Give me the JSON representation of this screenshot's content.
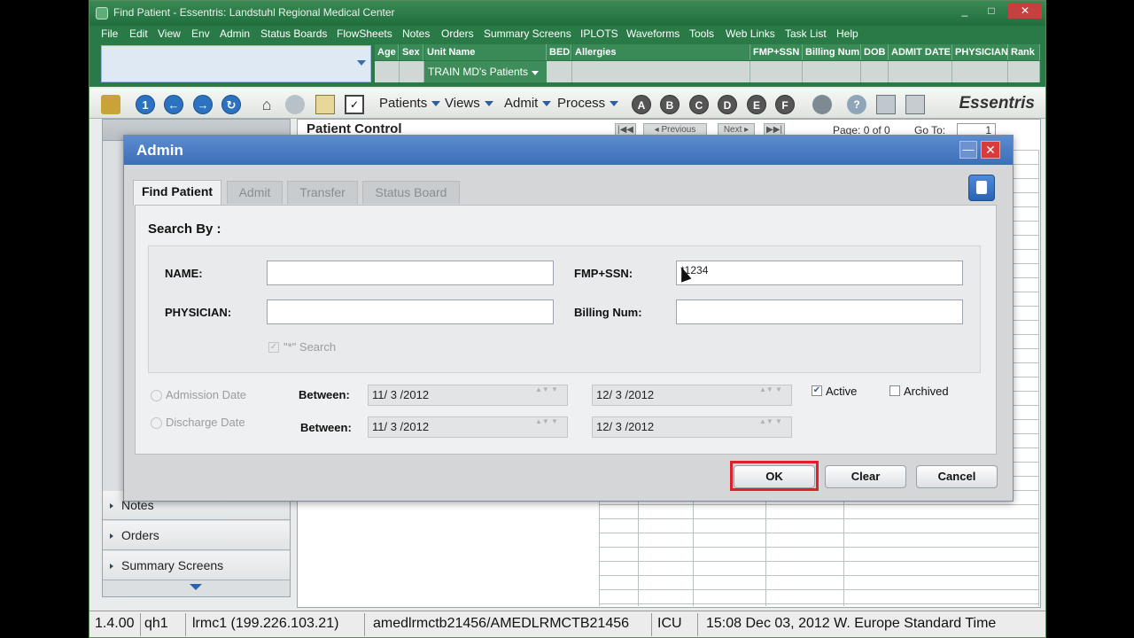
{
  "window": {
    "title": "Find Patient - Essentris: Landstuhl Regional Medical Center",
    "min": "_",
    "max": "□",
    "close": "✕"
  },
  "menu": [
    "File",
    "Edit",
    "View",
    "Env",
    "Admin",
    "Status Boards",
    "FlowSheets",
    "Notes",
    "Orders",
    "Summary Screens",
    "IPLOTS",
    "Waveforms",
    "Tools",
    "Web Links",
    "Task List",
    "Help"
  ],
  "patient_header": {
    "columns": [
      "Age",
      "Sex",
      "Unit Name",
      "BED",
      "Allergies",
      "FMP+SSN",
      "Billing Num",
      "DOB",
      "ADMIT DATE",
      "PHYSICIAN",
      "Rank"
    ],
    "unit_value": "TRAIN MD's Patients"
  },
  "toolbar": {
    "nav_numbers": [
      "1"
    ],
    "menus": [
      "Patients",
      "Views",
      "Admit",
      "Process"
    ],
    "letters": [
      "A",
      "B",
      "C",
      "D",
      "E",
      "F"
    ],
    "brand": "Essentris"
  },
  "sidebar": {
    "items": [
      "Notes",
      "Orders",
      "Summary Screens"
    ]
  },
  "main": {
    "title": "Patient Control",
    "pager": {
      "prev": "◂ Previous",
      "next": "Next ▸",
      "page": "Page: 0 of 0",
      "goto_label": "Go To:",
      "goto_value": "1"
    }
  },
  "dialog": {
    "title": "Admin",
    "tabs": [
      "Find Patient",
      "Admit",
      "Transfer",
      "Status Board"
    ],
    "search_by": "Search By :",
    "fields": {
      "name_label": "NAME:",
      "name_value": "",
      "physician_label": "PHYSICIAN:",
      "physician_value": "",
      "fmp_label": "FMP+SSN:",
      "fmp_value": "*1234",
      "billing_label": "Billing Num:",
      "billing_value": ""
    },
    "wildcard": "\"*\" Search",
    "admission_label": "Admission Date",
    "discharge_label": "Discharge Date",
    "between": "Between:",
    "adm_from": "11/ 3 /2012",
    "adm_to": "12/ 3 /2012",
    "dis_from": "11/ 3 /2012",
    "dis_to": "12/ 3 /2012",
    "active_label": "Active",
    "active_checked": "✔",
    "archived_label": "Archived",
    "ok": "OK",
    "clear": "Clear",
    "cancel": "Cancel"
  },
  "status": {
    "version": "1.4.00",
    "host": "qh1",
    "server": "lrmc1 (199.226.103.21)",
    "workstation": "amedlrmctb21456/AMEDLRMCTB21456",
    "unit": "ICU",
    "time": "15:08 Dec 03, 2012 W. Europe Standard Time"
  }
}
